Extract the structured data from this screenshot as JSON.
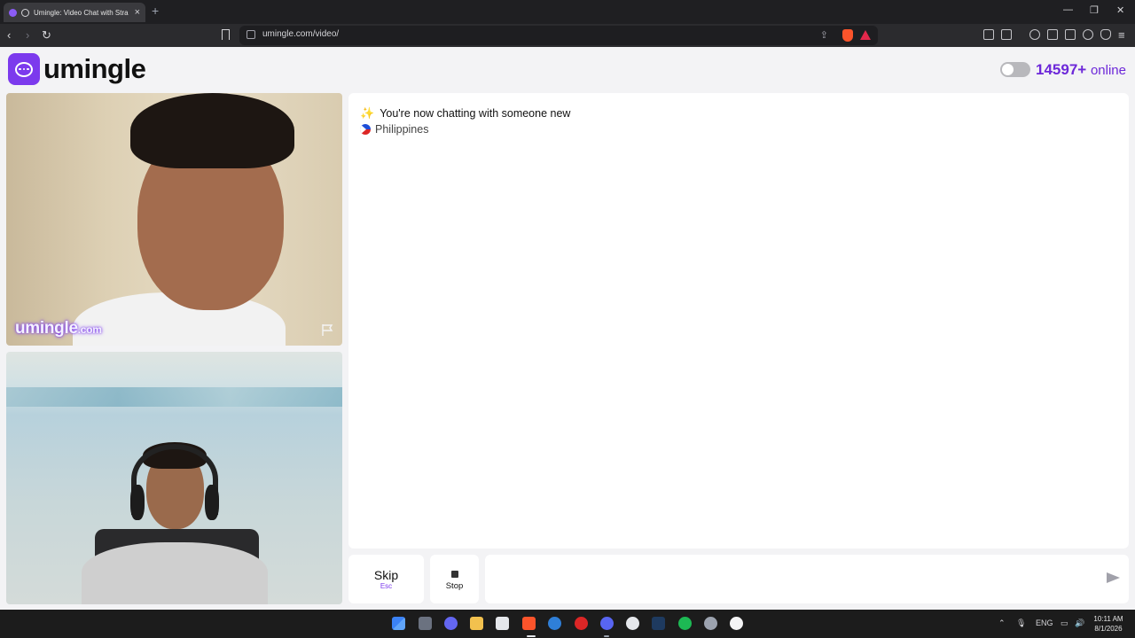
{
  "browser": {
    "tab_title": "Umingle: Video Chat with Stra",
    "new_tab_label": "+",
    "url": "umingle.com/video/",
    "window_controls": [
      "—",
      "❐",
      "✕"
    ]
  },
  "site": {
    "brand": "umingle",
    "online_count": "14597+",
    "online_label": "online",
    "toggle_on": false,
    "accent_color": "#7c3aed"
  },
  "video": {
    "watermark": "umingle",
    "watermark_suffix": ".com"
  },
  "chat": {
    "system_message": "You're now chatting with someone new",
    "country": "Philippines"
  },
  "controls": {
    "skip_label": "Skip",
    "skip_hint": "Esc",
    "stop_label": "Stop",
    "message_placeholder": ""
  },
  "taskbar": {
    "language": "ENG",
    "time": "10:11 AM",
    "date": "8/1/2026"
  }
}
